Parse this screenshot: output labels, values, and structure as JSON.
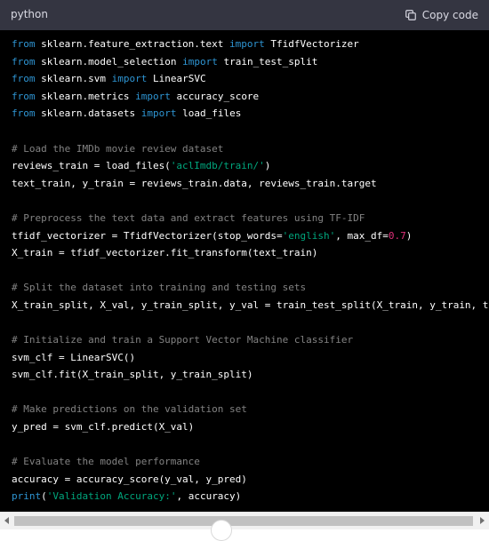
{
  "header": {
    "language": "python",
    "copy_label": "Copy code",
    "copy_icon": "clipboard-icon"
  },
  "code": {
    "lines": [
      [
        [
          "kw",
          "from"
        ],
        [
          "t",
          " sklearn.feature_extraction.text "
        ],
        [
          "kw",
          "import"
        ],
        [
          "t",
          " TfidfVectorizer"
        ]
      ],
      [
        [
          "kw",
          "from"
        ],
        [
          "t",
          " sklearn.model_selection "
        ],
        [
          "kw",
          "import"
        ],
        [
          "t",
          " train_test_split"
        ]
      ],
      [
        [
          "kw",
          "from"
        ],
        [
          "t",
          " sklearn.svm "
        ],
        [
          "kw",
          "import"
        ],
        [
          "t",
          " LinearSVC"
        ]
      ],
      [
        [
          "kw",
          "from"
        ],
        [
          "t",
          " sklearn.metrics "
        ],
        [
          "kw",
          "import"
        ],
        [
          "t",
          " accuracy_score"
        ]
      ],
      [
        [
          "kw",
          "from"
        ],
        [
          "t",
          " sklearn.datasets "
        ],
        [
          "kw",
          "import"
        ],
        [
          "t",
          " load_files"
        ]
      ],
      [],
      [
        [
          "cm",
          "# Load the IMDb movie review dataset"
        ]
      ],
      [
        [
          "t",
          "reviews_train = load_files("
        ],
        [
          "str",
          "'aclImdb/train/'"
        ],
        [
          "t",
          ")"
        ]
      ],
      [
        [
          "t",
          "text_train, y_train = reviews_train.data, reviews_train.target"
        ]
      ],
      [],
      [
        [
          "cm",
          "# Preprocess the text data and extract features using TF-IDF"
        ]
      ],
      [
        [
          "t",
          "tfidf_vectorizer = TfidfVectorizer(stop_words="
        ],
        [
          "str",
          "'english'"
        ],
        [
          "t",
          ", max_df="
        ],
        [
          "num",
          "0.7"
        ],
        [
          "t",
          ")"
        ]
      ],
      [
        [
          "t",
          "X_train = tfidf_vectorizer.fit_transform(text_train)"
        ]
      ],
      [],
      [
        [
          "cm",
          "# Split the dataset into training and testing sets"
        ]
      ],
      [
        [
          "t",
          "X_train_split, X_val, y_train_split, y_val = train_test_split(X_train, y_train, test_s"
        ]
      ],
      [],
      [
        [
          "cm",
          "# Initialize and train a Support Vector Machine classifier"
        ]
      ],
      [
        [
          "t",
          "svm_clf = LinearSVC()"
        ]
      ],
      [
        [
          "t",
          "svm_clf.fit(X_train_split, y_train_split)"
        ]
      ],
      [],
      [
        [
          "cm",
          "# Make predictions on the validation set"
        ]
      ],
      [
        [
          "t",
          "y_pred = svm_clf.predict(X_val)"
        ]
      ],
      [],
      [
        [
          "cm",
          "# Evaluate the model performance"
        ]
      ],
      [
        [
          "t",
          "accuracy = accuracy_score(y_val, y_pred)"
        ]
      ],
      [
        [
          "kw",
          "print"
        ],
        [
          "t",
          "("
        ],
        [
          "str",
          "'Validation Accuracy:'"
        ],
        [
          "t",
          ", accuracy)"
        ]
      ]
    ]
  },
  "colors": {
    "header_bg": "#343541",
    "code_bg": "#000000",
    "keyword": "#2e95d3",
    "string": "#00a67d",
    "number": "#df3079"
  }
}
